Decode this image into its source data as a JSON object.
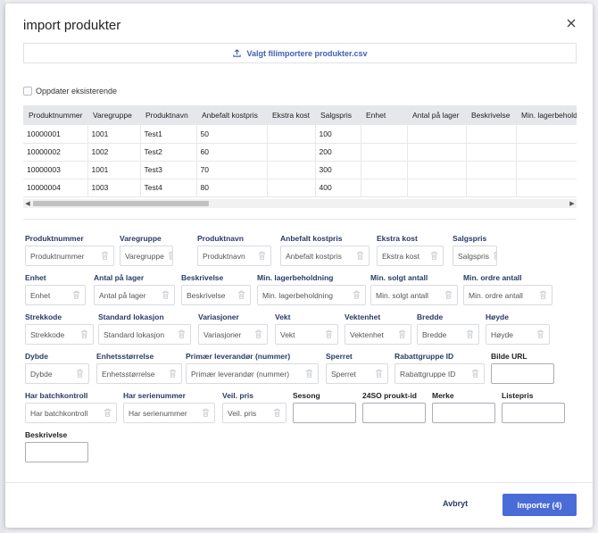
{
  "modal": {
    "title": "import produkter",
    "upload_label": "Valgt filimportere produkter.csv",
    "update_existing_label": "Oppdater eksisterende"
  },
  "table": {
    "columns": [
      "Produktnummer",
      "Varegruppe",
      "Produktnavn",
      "Anbefalt kostpris",
      "Ekstra kost",
      "Salgspris",
      "Enhet",
      "Antal på lager",
      "Beskrivelse",
      "Min. lagerbeholdning"
    ],
    "rows": [
      [
        "10000001",
        "1001",
        "Test1",
        "50",
        "",
        "100",
        "",
        "",
        "",
        ""
      ],
      [
        "10000002",
        "1002",
        "Test2",
        "60",
        "",
        "200",
        "",
        "",
        "",
        ""
      ],
      [
        "10000003",
        "1001",
        "Test3",
        "70",
        "",
        "300",
        "",
        "",
        "",
        ""
      ],
      [
        "10000004",
        "1003",
        "Test4",
        "80",
        "",
        "400",
        "",
        "",
        "",
        ""
      ]
    ]
  },
  "fields": [
    {
      "label": "Produktnummer",
      "value": "Produktnummer",
      "mapped": true
    },
    {
      "label": "Varegruppe",
      "value": "Varegruppe",
      "mapped": true
    },
    {
      "label": "Produktnavn",
      "value": "Produktnavn",
      "mapped": true
    },
    {
      "label": "Anbefalt kostpris",
      "value": "Anbefalt kostpris",
      "mapped": true
    },
    {
      "label": "Ekstra kost",
      "value": "Ekstra kost",
      "mapped": true
    },
    {
      "label": "Salgspris",
      "value": "Salgspris",
      "mapped": true
    },
    {
      "label": "Enhet",
      "value": "Enhet",
      "mapped": true
    },
    {
      "label": "Antal på lager",
      "value": "Antal på lager",
      "mapped": true
    },
    {
      "label": "Beskrivelse",
      "value": "Beskrivelse",
      "mapped": true
    },
    {
      "label": "Min. lagerbeholdning",
      "value": "Min. lagerbeholdning",
      "mapped": true
    },
    {
      "label": "Min. solgt antall",
      "value": "Min. solgt antall",
      "mapped": true
    },
    {
      "label": "Min. ordre antall",
      "value": "Min. ordre antall",
      "mapped": true
    },
    {
      "label": "Strekkode",
      "value": "Strekkode",
      "mapped": true
    },
    {
      "label": "Standard lokasjon",
      "value": "Standard lokasjon",
      "mapped": true
    },
    {
      "label": "Variasjoner",
      "value": "Variasjoner",
      "mapped": true
    },
    {
      "label": "Vekt",
      "value": "Vekt",
      "mapped": true
    },
    {
      "label": "Vektenhet",
      "value": "Vektenhet",
      "mapped": true
    },
    {
      "label": "Bredde",
      "value": "Bredde",
      "mapped": true
    },
    {
      "label": "Høyde",
      "value": "Høyde",
      "mapped": true
    },
    {
      "label": "Dybde",
      "value": "Dybde",
      "mapped": true
    },
    {
      "label": "Enhetsstørrelse",
      "value": "Enhetsstørrelse",
      "mapped": true
    },
    {
      "label": "Primær leverandør (nummer)",
      "value": "Primær leverandør (nummer)",
      "mapped": true
    },
    {
      "label": "Sperret",
      "value": "Sperret",
      "mapped": true
    },
    {
      "label": "Rabattgruppe ID",
      "value": "Rabattgruppe ID",
      "mapped": true
    },
    {
      "label": "Bilde URL",
      "value": "",
      "mapped": false
    },
    {
      "label": "Har batchkontroll",
      "value": "Har batchkontroll",
      "mapped": true
    },
    {
      "label": "Har serienummer",
      "value": "Har serienummer",
      "mapped": true
    },
    {
      "label": "Veil. pris",
      "value": "Veil. pris",
      "mapped": true
    },
    {
      "label": "Sesong",
      "value": "",
      "mapped": false
    },
    {
      "label": "24SO proukt-id",
      "value": "",
      "mapped": false
    },
    {
      "label": "Merke",
      "value": "",
      "mapped": false
    },
    {
      "label": "Listepris",
      "value": "",
      "mapped": false
    },
    {
      "label": "Beskrivelse",
      "value": "",
      "mapped": false
    }
  ],
  "footer": {
    "cancel_label": "Avbryt",
    "import_label": "Importer (4)"
  },
  "colors": {
    "accent": "#4a6cd6",
    "label": "#2b3a67"
  }
}
